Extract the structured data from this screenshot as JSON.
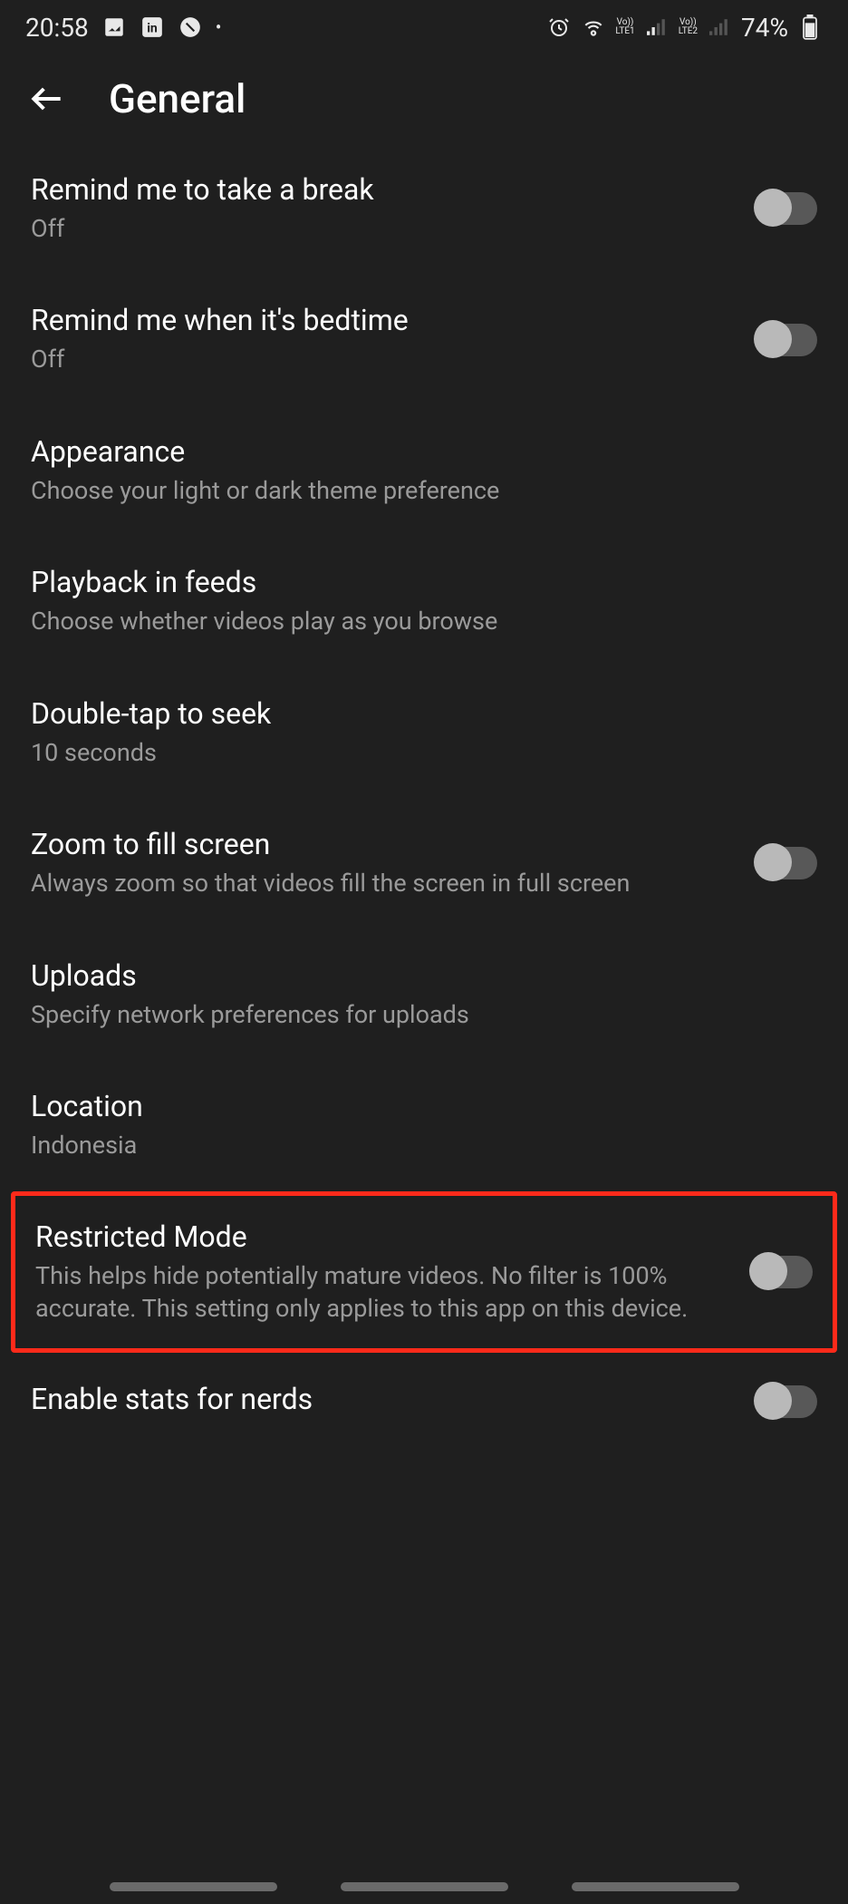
{
  "status": {
    "time": "20:58",
    "battery": "74%"
  },
  "header": {
    "title": "General"
  },
  "settings": {
    "break": {
      "title": "Remind me to take a break",
      "sub": "Off"
    },
    "bedtime": {
      "title": "Remind me when it's bedtime",
      "sub": "Off"
    },
    "appearance": {
      "title": "Appearance",
      "sub": "Choose your light or dark theme preference"
    },
    "playback": {
      "title": "Playback in feeds",
      "sub": "Choose whether videos play as you browse"
    },
    "doubletap": {
      "title": "Double-tap to seek",
      "sub": "10 seconds"
    },
    "zoom": {
      "title": "Zoom to fill screen",
      "sub": "Always zoom so that videos fill the screen in full screen"
    },
    "uploads": {
      "title": "Uploads",
      "sub": "Specify network preferences for uploads"
    },
    "location": {
      "title": "Location",
      "sub": "Indonesia"
    },
    "restricted": {
      "title": "Restricted Mode",
      "sub": "This helps hide potentially mature videos. No filter is 100% accurate. This setting only applies to this app on this device."
    },
    "stats": {
      "title": "Enable stats for nerds"
    }
  }
}
